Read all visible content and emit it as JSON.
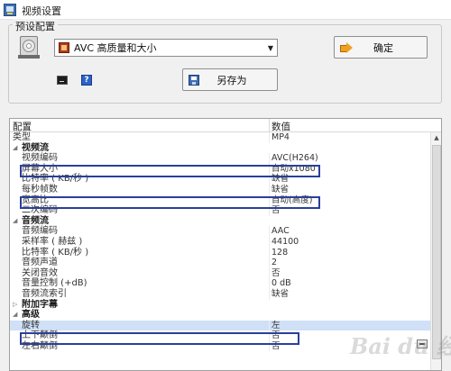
{
  "window": {
    "title": "视频设置"
  },
  "preset": {
    "legend": "预设配置",
    "selected": "AVC 高质量和大小",
    "confirm_label": "确定",
    "saveas_label": "另存为",
    "help_glyph": "?"
  },
  "grid": {
    "header_name": "配置",
    "header_value": "数值",
    "rows": [
      {
        "name": "类型",
        "value": "MP4"
      },
      {
        "name": "视频流",
        "value": ""
      },
      {
        "name": "视频编码",
        "value": "AVC(H264)"
      },
      {
        "name": "屏幕大小",
        "value": "自动x1080"
      },
      {
        "name": "比特率 ( KB/秒 )",
        "value": "缺省"
      },
      {
        "name": "每秒帧数",
        "value": "缺省"
      },
      {
        "name": "宽高比",
        "value": "自动(高度)"
      },
      {
        "name": "二次编码",
        "value": "否"
      },
      {
        "name": "音频流",
        "value": ""
      },
      {
        "name": "音频编码",
        "value": "AAC"
      },
      {
        "name": "采样率 ( 赫兹 )",
        "value": "44100"
      },
      {
        "name": "比特率 ( KB/秒 )",
        "value": "128"
      },
      {
        "name": "音频声道",
        "value": "2"
      },
      {
        "name": "关闭音效",
        "value": "否"
      },
      {
        "name": "音量控制 (+dB)",
        "value": "0 dB"
      },
      {
        "name": "音频流索引",
        "value": "缺省"
      },
      {
        "name": "附加字幕",
        "value": ""
      },
      {
        "name": "高级",
        "value": ""
      },
      {
        "name": "旋转",
        "value": "左"
      },
      {
        "name": "上下颠倒",
        "value": "否"
      },
      {
        "name": "左右颠倒",
        "value": "否"
      }
    ]
  },
  "watermark": {
    "text": "Bai du 经验"
  },
  "colors": {
    "highlight": "#2a3f9c",
    "selected_row": "#cfe0f7"
  }
}
